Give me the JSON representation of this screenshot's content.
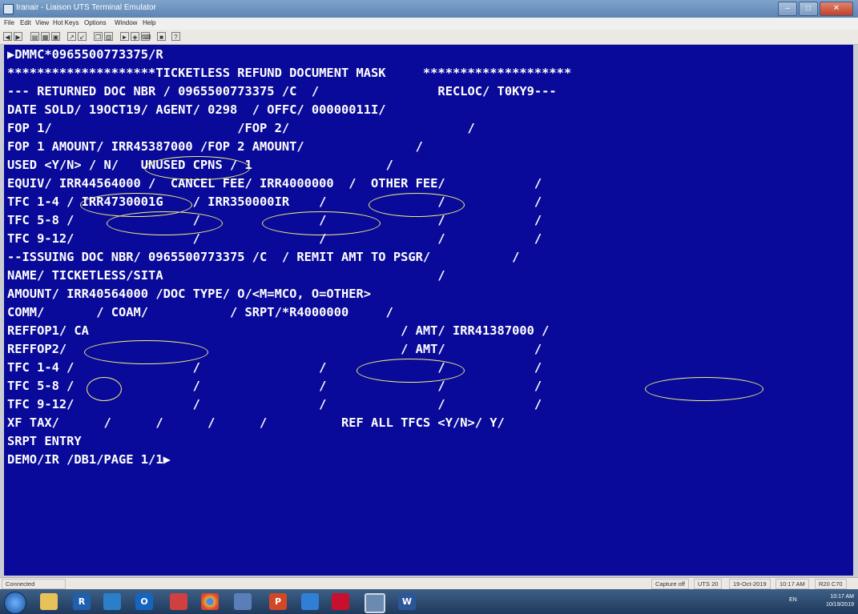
{
  "window": {
    "title": "Iranair - Liaison UTS Terminal Emulator",
    "controls": {
      "minimize": "–",
      "maximize": "□",
      "close": "✕"
    }
  },
  "menu": [
    "File",
    "Edit",
    "View",
    "Hot Keys",
    "Options",
    "Window",
    "Help"
  ],
  "toolbar": {
    "icons": [
      "back-icon",
      "forward-icon",
      "print-icon",
      "print-screen-icon",
      "save-icon",
      "send-icon",
      "receive-icon",
      "copy-icon",
      "paste-icon",
      "run-icon",
      "macro-icon",
      "keyboard-icon",
      "settings-icon",
      "help-icon"
    ]
  },
  "terminal": {
    "lines": [
      "▶DMMC*0965500773375/R",
      "********************TICKETLESS REFUND DOCUMENT MASK     ********************",
      "--- RETURNED DOC NBR / 0965500773375 /C  /                RECLOC/ T0KY9---",
      "DATE SOLD/ 19OCT19/ AGENT/ 0298  / OFFC/ 00000011I/",
      "FOP 1/                         /FOP 2/                        /",
      "FOP 1 AMOUNT/ IRR45387000 /FOP 2 AMOUNT/               /",
      "USED <Y/N> / N/   UNUSED CPNS / 1                  /",
      "EQUIV/ IRR44564000 /  CANCEL FEE/ IRR4000000  /  OTHER FEE/            /",
      "TFC 1-4 / IRR4730001G    / IRR350000IR    /               /            /",
      "TFC 5-8 /                /                /               /            /",
      "TFC 9-12/                /                /               /            /",
      "--ISSUING DOC NBR/ 0965500773375 /C  / REMIT AMT TO PSGR/           /",
      "NAME/ TICKETLESS/SITA                                     /",
      "AMOUNT/ IRR40564000 /DOC TYPE/ O/<M=MCO, O=OTHER>",
      "COMM/       / COAM/           / SRPT/*R4000000     /",
      "REFFOP1/ CA                                          / AMT/ IRR41387000 /",
      "REFFOP2/                                             / AMT/            /",
      "TFC 1-4 /                /                /               /            /",
      "TFC 5-8 /                /                /               /            /",
      "TFC 9-12/                /                /               /            /",
      "XF TAX/      /      /      /      /          REF ALL TFCS <Y/N>/ Y/",
      "SRPT ENTRY",
      "DEMO/IR /DB1/PAGE 1/1▶"
    ],
    "text_color": "#ffffff",
    "background": "#0a0a9a",
    "highlight_color": "#f2f27a"
  },
  "status": {
    "connection": "Connected",
    "capture": "Capture off",
    "session": "UTS 20",
    "date": "19-Oct-2019",
    "time": "10:17 AM",
    "position": "R20 C70"
  },
  "taskbar": {
    "apps": [
      {
        "icon": "file-explorer-icon",
        "label": ""
      },
      {
        "icon": "r-app-icon",
        "label": "R"
      },
      {
        "icon": "media-icon",
        "label": ""
      },
      {
        "icon": "outlook-icon",
        "label": "O"
      },
      {
        "icon": "camera-icon",
        "label": ""
      },
      {
        "icon": "chrome-icon",
        "label": ""
      },
      {
        "icon": "network-icon",
        "label": ""
      },
      {
        "icon": "powerpoint-icon",
        "label": "P"
      },
      {
        "icon": "shield-icon",
        "label": ""
      },
      {
        "icon": "acrobat-icon",
        "label": ""
      },
      {
        "icon": "terminal-app-icon",
        "label": ""
      },
      {
        "icon": "word-icon",
        "label": "W"
      }
    ],
    "language": "EN",
    "clock_time": "10:17 AM",
    "clock_date": "10/19/2019"
  }
}
